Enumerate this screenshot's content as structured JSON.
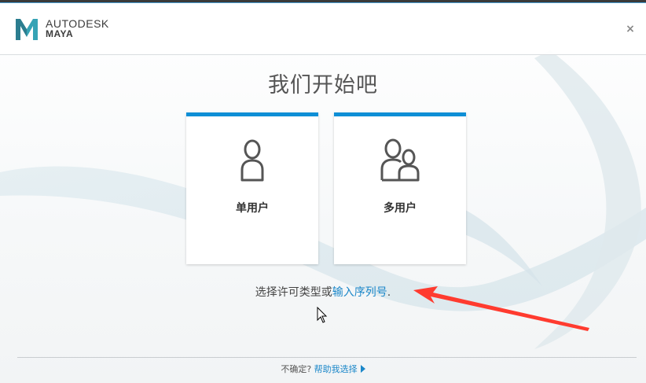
{
  "header": {
    "brand": "AUTODESK",
    "product": "MAYA",
    "logo_icon": "maya-m-logo-icon",
    "close_icon": "close-icon",
    "close_label": "×"
  },
  "main": {
    "title": "我们开始吧",
    "cards": [
      {
        "label": "单用户",
        "icon": "single-user-icon"
      },
      {
        "label": "多用户",
        "icon": "multi-user-icon"
      }
    ],
    "prompt_text": "选择许可类型或",
    "prompt_link": "输入序列号",
    "prompt_end": "."
  },
  "footer": {
    "question": "不确定?",
    "help_link": "帮助我选择",
    "help_icon": "play-triangle-icon"
  },
  "colors": {
    "accent": "#0f8fd6",
    "link": "#1b87c9",
    "annotation_arrow": "#ff3b2f"
  }
}
